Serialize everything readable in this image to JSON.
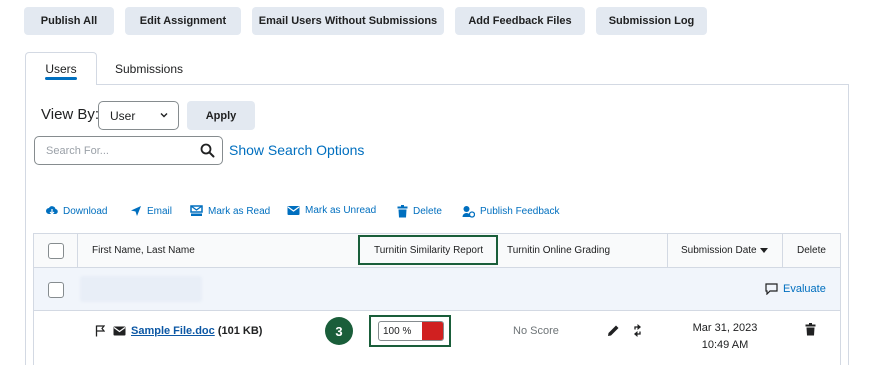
{
  "toolbar": {
    "publish_all": "Publish All",
    "edit_assignment": "Edit Assignment",
    "email_users": "Email Users Without Submissions",
    "add_feedback": "Add Feedback Files",
    "submission_log": "Submission Log"
  },
  "tabs": [
    {
      "label": "Users",
      "active": true
    },
    {
      "label": "Submissions",
      "active": false
    }
  ],
  "view_by": {
    "label": "View By:",
    "selected": "User",
    "apply": "Apply"
  },
  "search": {
    "placeholder": "Search For...",
    "options_link": "Show Search Options"
  },
  "actions": [
    {
      "label": "Download",
      "icon": "download-icon"
    },
    {
      "label": "Email",
      "icon": "send-icon"
    },
    {
      "label": "Mark as Read",
      "icon": "mark-read-icon"
    },
    {
      "label": "Mark as Unread",
      "icon": "envelope-icon"
    },
    {
      "label": "Delete",
      "icon": "trash-icon"
    },
    {
      "label": "Publish Feedback",
      "icon": "publish-feedback-icon"
    }
  ],
  "table": {
    "columns": {
      "name": "First Name, Last Name",
      "similarity": "Turnitin Similarity Report",
      "grading": "Turnitin Online Grading",
      "date": "Submission Date",
      "delete": "Delete"
    },
    "evaluate": "Evaluate",
    "file": {
      "name": "Sample File.doc",
      "size": "(101 KB)",
      "similarity": "100 %",
      "similarity_value": 100,
      "similarity_color": "#d02020",
      "grading": "No Score",
      "date": "Mar 31, 2023",
      "time": "10:49 AM"
    }
  },
  "callout": {
    "number": "3",
    "color": "#1a5e3a"
  }
}
